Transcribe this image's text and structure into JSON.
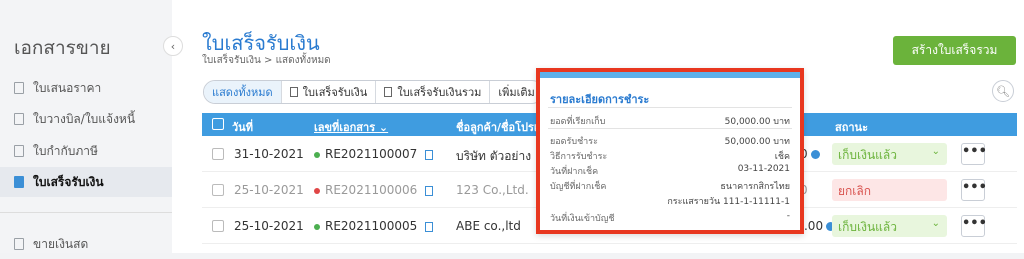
{
  "sidebar": {
    "title": "เอกสารขาย",
    "collapse_icon": "‹",
    "items": [
      {
        "label": "ใบเสนอราคา"
      },
      {
        "label": "ใบวางบิล/ใบแจ้งหนี้"
      },
      {
        "label": "ใบกำกับภาษี"
      },
      {
        "label": "ใบเสร็จรับเงิน"
      },
      {
        "label": "ขายเงินสด"
      }
    ]
  },
  "header": {
    "title": "ใบเสร็จรับเงิน",
    "breadcrumb": "ใบเสร็จรับเงิน > แสดงทั้งหมด",
    "create_button": "สร้างใบเสร็จรวม"
  },
  "filters": [
    "แสดงทั้งหมด",
    "ใบเสร็จรับเงิน",
    "ใบเสร็จรับเงินรวม",
    "เพิ่มเติม"
  ],
  "table": {
    "headers": {
      "date": "วันที่",
      "doc_no": "เลขที่เอกสาร ⌄",
      "customer": "ชื่อลูกค้า/ชื่อโปรเ",
      "status": "สถานะ"
    },
    "rows": [
      {
        "date": "31-10-2021",
        "doc_no": "RE2021100007",
        "customer": "บริษัท ตัวอย่าง 1",
        "amount": "0",
        "status": "เก็บเงินแล้ว",
        "more": "•••"
      },
      {
        "date": "25-10-2021",
        "doc_no": "RE2021100006",
        "customer": "123 Co.,Ltd.",
        "amount": "0",
        "status": "ยกเลิก",
        "more": "•••"
      },
      {
        "date": "25-10-2021",
        "doc_no": "RE2021100005",
        "customer": "ABE co.,ltd",
        "amount": "50,000.00",
        "status": "เก็บเงินแล้ว",
        "more": "•••"
      }
    ]
  },
  "popup": {
    "title": "รายละเอียดการชำระ",
    "amount_due_label": "ยอดที่เรียกเก็บ",
    "amount_due_value": "50,000.00 บาท",
    "received_label": "ยอดรับชำระ",
    "received_value": "50,000.00 บาท",
    "method_label": "วิธีการรับชำระ",
    "method_value": "เช็ค",
    "deposit_date_label": "วันที่ฝากเช็ค",
    "deposit_date_value": "03-11-2021",
    "account_label": "บัญชีที่ฝากเช็ค",
    "account_bank": "ธนาคารกสิกรไทย",
    "account_number": "กระแสรายวัน 111-1-11111-1",
    "cleared_date_label": "วันที่เงินเข้าบัญชี",
    "cleared_date_value": "-"
  },
  "colors": {
    "accent": "#3f9ce0",
    "primary_button": "#6bb33b",
    "highlight_border": "#e8371f"
  }
}
